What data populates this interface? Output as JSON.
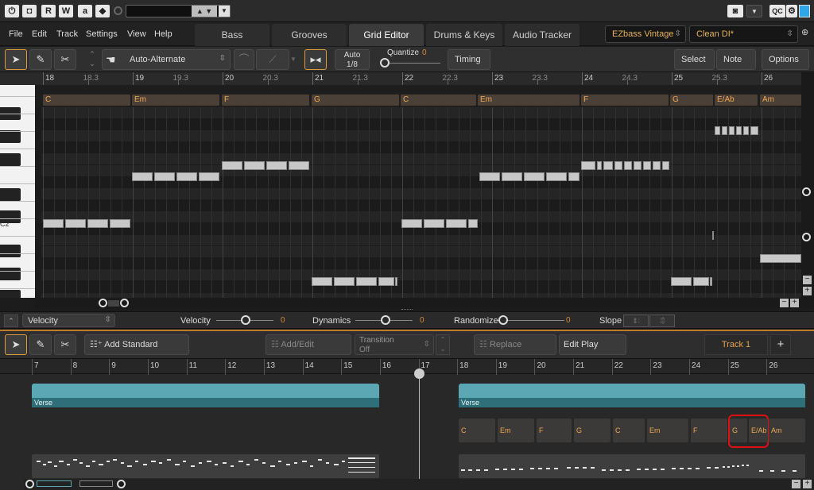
{
  "topbar": {
    "btn_power": "⏻",
    "btn_stop": "◘",
    "btn_r": "R",
    "btn_w": "W",
    "btn_a": "a",
    "btn_arrow": "◆",
    "btn_qc": "QC"
  },
  "menu": [
    "File",
    "Edit",
    "Track",
    "Settings",
    "View",
    "Help"
  ],
  "tabs": [
    "Bass",
    "Grooves",
    "Grid Editor",
    "Drums & Keys",
    "Audio Tracker"
  ],
  "presets": {
    "instrument": "EZbass Vintage",
    "amp": "Clean DI*"
  },
  "toolbar": {
    "mode": "Auto-Alternate",
    "auto_label": "Auto",
    "auto_value": "1/8",
    "quantize_label": "Quantize",
    "quantize_value": "0",
    "timing": "Timing",
    "select": "Select",
    "note": "Note",
    "options": "Options"
  },
  "ruler": [
    {
      "label": "18",
      "major": true
    },
    {
      "label": "18.3",
      "major": false
    },
    {
      "label": "19",
      "major": true
    },
    {
      "label": "19.3",
      "major": false
    },
    {
      "label": "20",
      "major": true
    },
    {
      "label": "20.3",
      "major": false
    },
    {
      "label": "21",
      "major": true
    },
    {
      "label": "21.3",
      "major": false
    },
    {
      "label": "22",
      "major": true
    },
    {
      "label": "22.3",
      "major": false
    },
    {
      "label": "23",
      "major": true
    },
    {
      "label": "23.3",
      "major": false
    },
    {
      "label": "24",
      "major": true
    },
    {
      "label": "24.3",
      "major": false
    },
    {
      "label": "25",
      "major": true
    },
    {
      "label": "25.3",
      "major": false
    },
    {
      "label": "26",
      "major": true
    }
  ],
  "chords_top": [
    "C",
    "Em",
    "F",
    "G",
    "C",
    "Em",
    "F",
    "G",
    "E/Ab",
    "Am"
  ],
  "piano": {
    "c2_label": "C2"
  },
  "velocity_row": {
    "mode": "Velocity",
    "sliders": [
      {
        "label": "Velocity",
        "value": "0"
      },
      {
        "label": "Dynamics",
        "value": "0"
      },
      {
        "label": "Randomize",
        "value": "0"
      }
    ],
    "slope_label": "Slope"
  },
  "lower_toolbar": {
    "add_groove": "Add Standard Groove",
    "add_chords": "Add/Edit Chords",
    "transition_label": "Transition",
    "transition_value": "Off",
    "replace_midi": "Replace MIDI...",
    "edit_play_style": "Edit Play Style",
    "track": "Track 1",
    "add": "+"
  },
  "lower_ruler": [
    "7",
    "8",
    "9",
    "10",
    "11",
    "12",
    "13",
    "14",
    "15",
    "16",
    "17",
    "18",
    "19",
    "20",
    "21",
    "22",
    "23",
    "24",
    "25",
    "26"
  ],
  "parts": [
    {
      "label": "Verse"
    },
    {
      "label": "Verse"
    }
  ],
  "chords_bottom": [
    "C",
    "Em",
    "F",
    "G",
    "C",
    "Em",
    "F",
    "G",
    "E/Ab",
    "Am"
  ],
  "colors": {
    "accent": "#c07a2c",
    "chord_text": "#f0a850",
    "part": "#5ba8b4",
    "highlight": "#e01010"
  }
}
